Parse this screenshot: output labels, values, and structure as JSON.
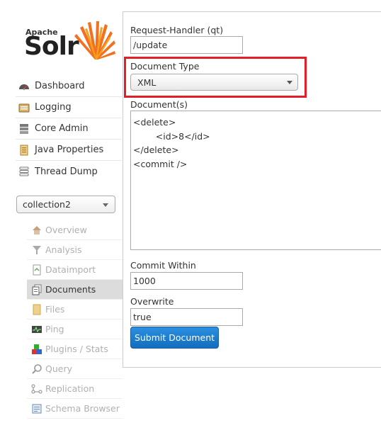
{
  "logo": {
    "top_text": "Apache",
    "main_text": "Solr"
  },
  "main_nav": [
    {
      "label": "Dashboard",
      "icon": "dashboard-icon"
    },
    {
      "label": "Logging",
      "icon": "logging-icon"
    },
    {
      "label": "Core Admin",
      "icon": "core-admin-icon"
    },
    {
      "label": "Java Properties",
      "icon": "java-properties-icon"
    },
    {
      "label": "Thread Dump",
      "icon": "thread-dump-icon"
    }
  ],
  "core_selector": {
    "selected": "collection2"
  },
  "core_nav": [
    {
      "label": "Overview",
      "icon": "overview-icon",
      "active": false
    },
    {
      "label": "Analysis",
      "icon": "analysis-icon",
      "active": false
    },
    {
      "label": "Dataimport",
      "icon": "dataimport-icon",
      "active": false
    },
    {
      "label": "Documents",
      "icon": "documents-icon",
      "active": true
    },
    {
      "label": "Files",
      "icon": "files-icon",
      "active": false
    },
    {
      "label": "Ping",
      "icon": "ping-icon",
      "active": false
    },
    {
      "label": "Plugins / Stats",
      "icon": "plugins-icon",
      "active": false
    },
    {
      "label": "Query",
      "icon": "query-icon",
      "active": false
    },
    {
      "label": "Replication",
      "icon": "replication-icon",
      "active": false
    },
    {
      "label": "Schema Browser",
      "icon": "schema-browser-icon",
      "active": false
    }
  ],
  "form": {
    "request_handler_label": "Request-Handler (qt)",
    "request_handler_value": "/update",
    "document_type_label": "Document Type",
    "document_type_value": "XML",
    "documents_label": "Document(s)",
    "documents_value": "<delete>\n        <id>8</id>\n</delete>\n<commit />",
    "commit_within_label": "Commit Within",
    "commit_within_value": "1000",
    "overwrite_label": "Overwrite",
    "overwrite_value": "true",
    "submit_label": "Submit Document"
  },
  "colors": {
    "highlight": "#e21f26",
    "button": "#1f7ed0",
    "active_nav": "#dcdcdc"
  }
}
